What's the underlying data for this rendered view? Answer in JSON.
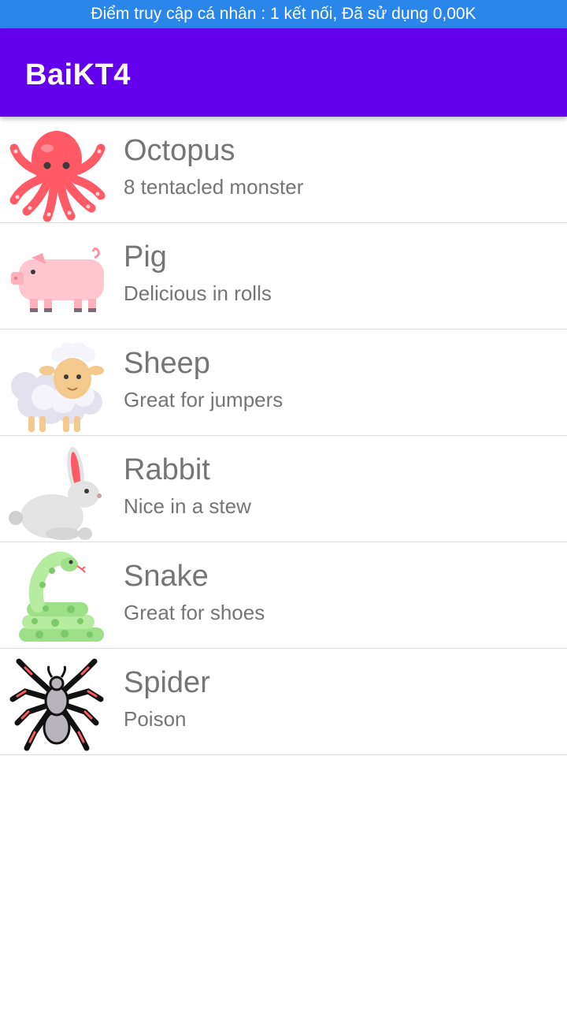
{
  "status_bar": {
    "text": "Điểm truy cập cá nhân : 1 kết nối, Đã sử dụng 0,00K"
  },
  "app_bar": {
    "title": "BaiKT4"
  },
  "colors": {
    "status_bar": "#2a86e8",
    "app_bar": "#6200ee",
    "text": "#757575"
  },
  "animals": [
    {
      "name": "Octopus",
      "description": "8 tentacled monster",
      "icon": "octopus-icon"
    },
    {
      "name": "Pig",
      "description": "Delicious in rolls",
      "icon": "pig-icon"
    },
    {
      "name": "Sheep",
      "description": "Great for jumpers",
      "icon": "sheep-icon"
    },
    {
      "name": "Rabbit",
      "description": "Nice in a stew",
      "icon": "rabbit-icon"
    },
    {
      "name": "Snake",
      "description": "Great for shoes",
      "icon": "snake-icon"
    },
    {
      "name": "Spider",
      "description": "Poison",
      "icon": "spider-icon"
    }
  ]
}
